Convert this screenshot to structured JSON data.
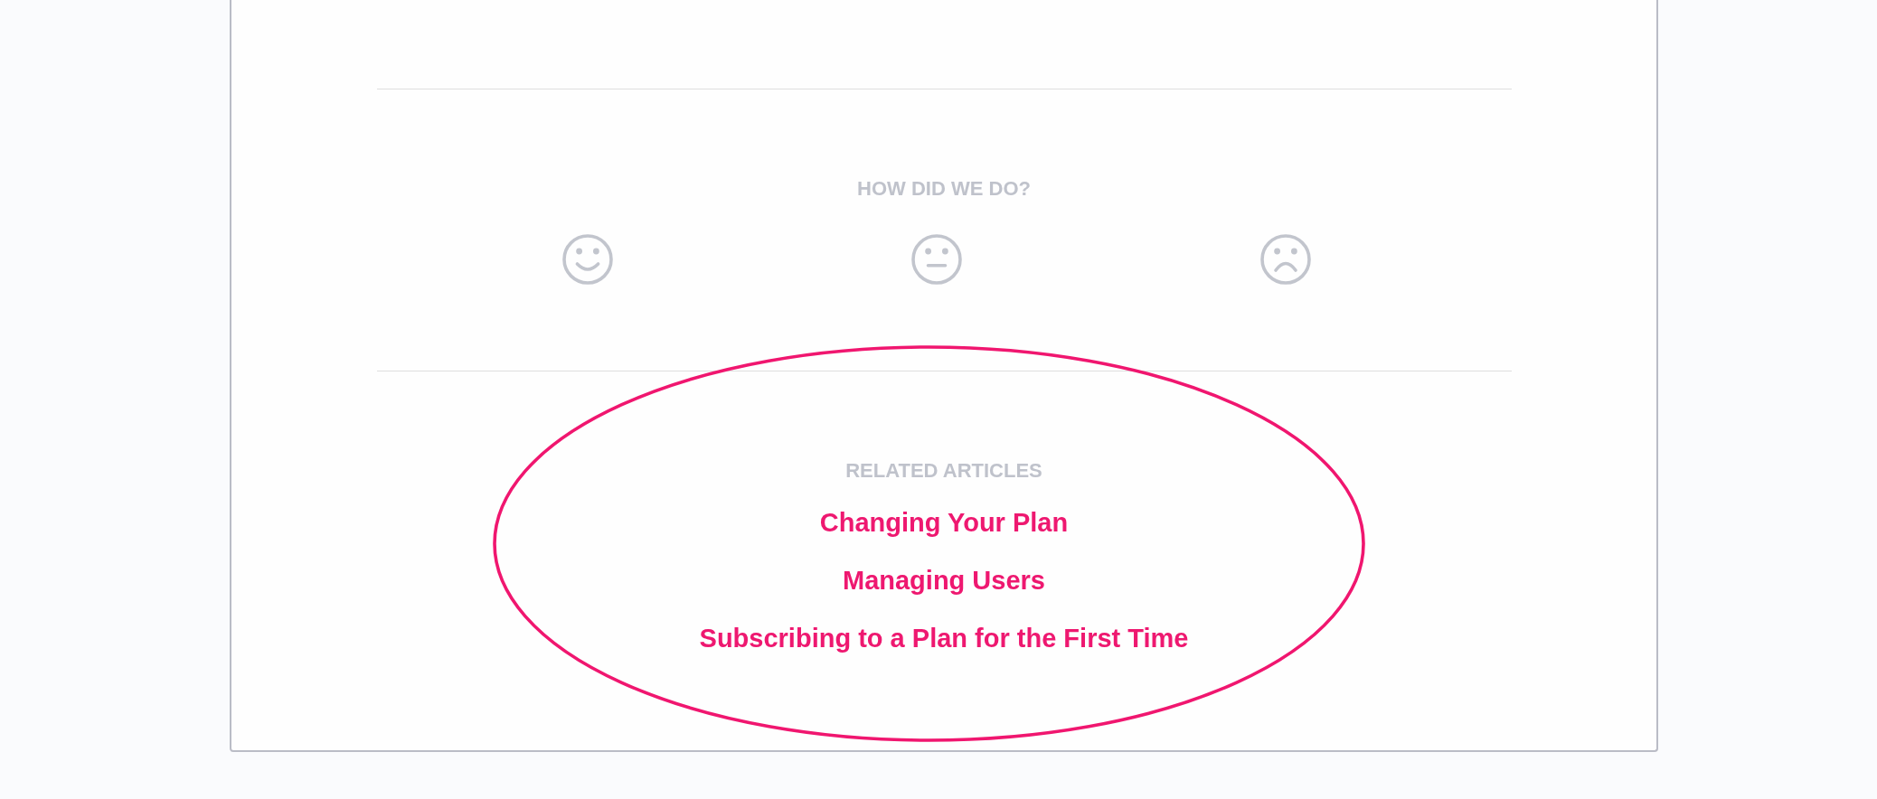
{
  "feedback": {
    "title": "HOW DID WE DO?",
    "options": [
      {
        "kind": "happy"
      },
      {
        "kind": "neutral"
      },
      {
        "kind": "sad"
      }
    ]
  },
  "related_articles": {
    "title": "RELATED ARTICLES",
    "links": [
      "Changing Your Plan",
      "Managing Users",
      "Subscribing to a Plan for the First Time"
    ]
  },
  "annotation": {
    "kind": "ellipse"
  }
}
